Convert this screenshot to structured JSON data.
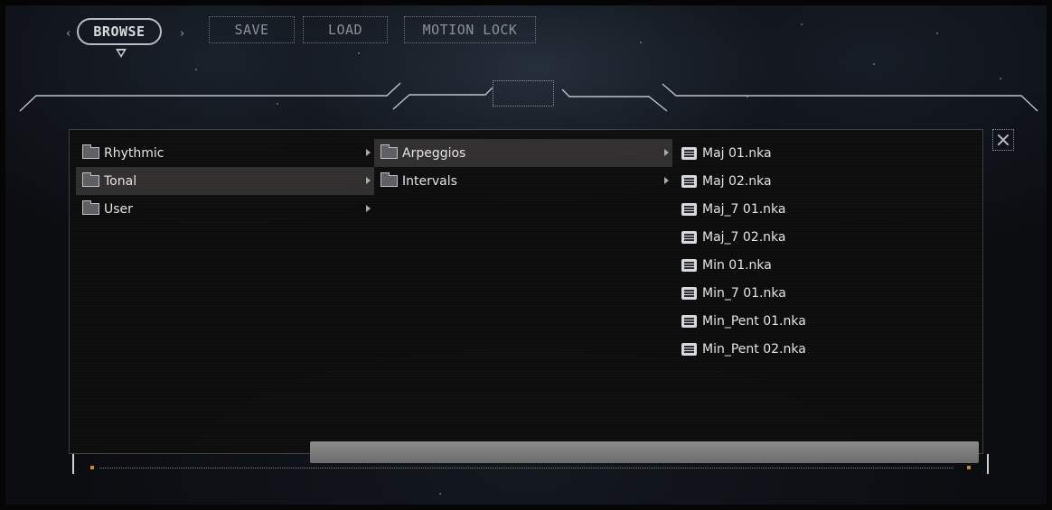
{
  "toolbar": {
    "prev_arrow": "‹",
    "browse_label": "BROWSE",
    "next_arrow": "›",
    "save_label": "SAVE",
    "load_label": "LOAD",
    "motion_lock_label": "MOTION LOCK"
  },
  "browser": {
    "column1": [
      {
        "label": "Rhythmic",
        "type": "folder",
        "selected": false
      },
      {
        "label": "Tonal",
        "type": "folder",
        "selected": true
      },
      {
        "label": "User",
        "type": "folder",
        "selected": false
      }
    ],
    "column2": [
      {
        "label": "Arpeggios",
        "type": "folder",
        "selected": true
      },
      {
        "label": "Intervals",
        "type": "folder",
        "selected": false
      }
    ],
    "column3": [
      {
        "label": "Maj 01.nka",
        "type": "file"
      },
      {
        "label": "Maj 02.nka",
        "type": "file"
      },
      {
        "label": "Maj_7 01.nka",
        "type": "file"
      },
      {
        "label": "Maj_7 02.nka",
        "type": "file"
      },
      {
        "label": "Min 01.nka",
        "type": "file"
      },
      {
        "label": "Min_7 01.nka",
        "type": "file"
      },
      {
        "label": "Min_Pent 01.nka",
        "type": "file"
      },
      {
        "label": "Min_Pent 02.nka",
        "type": "file"
      }
    ]
  },
  "icons": {
    "folder": "folder-icon",
    "file": "list-file-icon",
    "submenu": "chevron-right-icon",
    "close": "close-icon"
  },
  "colors": {
    "accent_orange": "#c8892f",
    "selection": "#5f5a58",
    "scrollbar": "#7c7c7c"
  }
}
